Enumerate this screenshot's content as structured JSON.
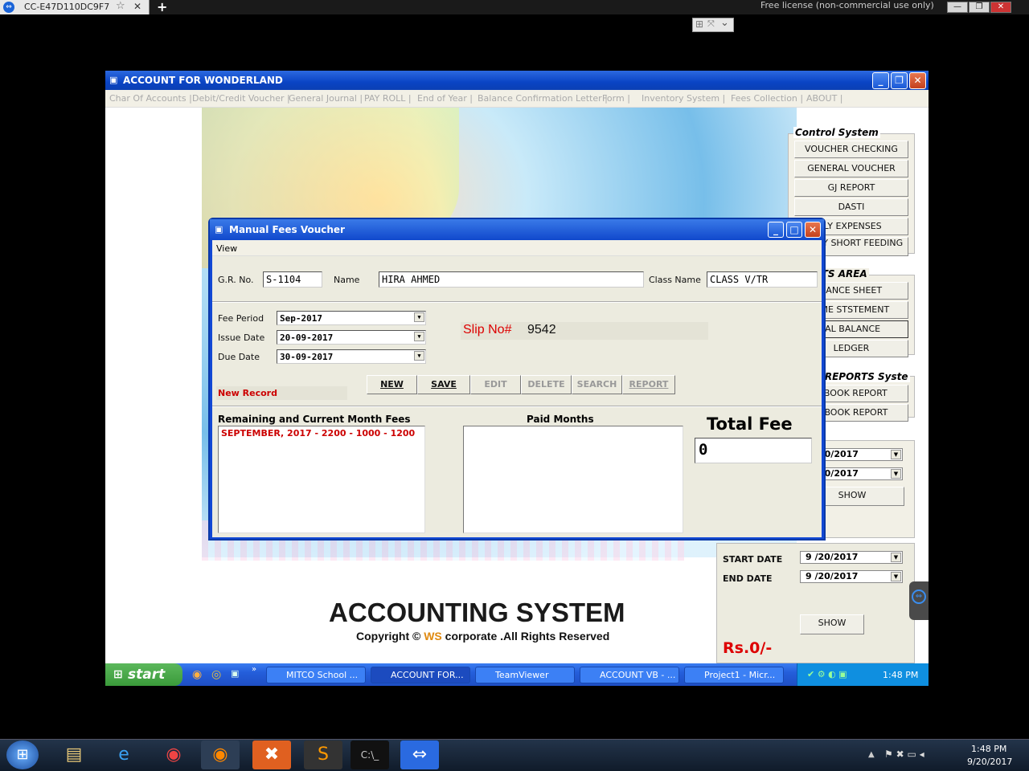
{
  "teamviewer": {
    "tab_label": "CC-E47D110DC9F7",
    "license_text": "Free license (non-commercial use only)"
  },
  "app": {
    "title": "ACCOUNT FOR WONDERLAND",
    "menu": [
      "Char Of Accounts |",
      "Debit/Credit Voucher |",
      "General Journal |",
      "PAY ROLL |",
      "End of Year |",
      "Balance Confirmation Letter |",
      "Form |",
      "Inventory System |",
      "Fees Collection |",
      "ABOUT |"
    ],
    "brand_title": "ACCOUNTING SYSTEM",
    "copyright_pre": "Copyright ©",
    "copyright_ws": "WS",
    "copyright_post": "corporate .All Rights Reserved"
  },
  "control_system": {
    "legend": "Control System",
    "buttons": [
      "VOUCHER CHECKING",
      "GENERAL VOUCHER",
      "GJ REPORT",
      "DASTI",
      "ILY EXPENSES",
      "ALARY SHORT FEEDING"
    ]
  },
  "reports_area": {
    "legend": "RTS AREA",
    "buttons": [
      "LANCE SHEET",
      "OME STSTEMENT",
      "IAL BALANCE",
      "LEDGER"
    ]
  },
  "reports_system": {
    "legend": "Y REPORTS  Syste",
    "buttons": [
      "K BOOK REPORT",
      "H BOOK REPORT"
    ]
  },
  "date_panel_a": {
    "date1": "20/2017",
    "date2": "20/2017",
    "show_label": "SHOW"
  },
  "date_panel_b": {
    "start_label": "START DATE",
    "start_value": "9 /20/2017",
    "end_label": "END DATE",
    "end_value": "9 /20/2017",
    "show_label": "SHOW",
    "amount": "Rs.0/-"
  },
  "dialog": {
    "title": "Manual Fees Voucher",
    "menu_view": "View",
    "gr_label": "G.R. No.",
    "gr_value": "S-1104",
    "name_label": "Name",
    "name_value": "HIRA AHMED",
    "class_label": "Class Name",
    "class_value": "CLASS V/TR",
    "fee_period_label": "Fee Period",
    "fee_period_value": "Sep-2017",
    "issue_date_label": "Issue Date",
    "issue_date_value": "20-09-2017",
    "due_date_label": "Due Date",
    "due_date_value": "30-09-2017",
    "slip_label": "Slip No#",
    "slip_value": "9542",
    "buttons": {
      "new": "NEW",
      "save": "SAVE",
      "edit": "EDIT",
      "delete": "DELETE",
      "search": "SEARCH",
      "report": "REPORT"
    },
    "status": "New Record",
    "remaining_label": "Remaining and Current Month Fees",
    "remaining_items": [
      "SEPTEMBER, 2017 - 2200 - 1000 - 1200"
    ],
    "paid_label": "Paid Months",
    "total_label": "Total Fee",
    "total_value": "0"
  },
  "xp_taskbar": {
    "start_label": "start",
    "items": [
      "MITCO School ...",
      "ACCOUNT FOR...",
      "TeamViewer",
      "ACCOUNT VB - ...",
      "Project1 - Micr..."
    ],
    "clock": "1:48 PM"
  },
  "win7_taskbar": {
    "time": "1:48 PM",
    "date": "9/20/2017"
  },
  "colors": {
    "xp_blue": "#245edb",
    "slip_red": "#d00000",
    "status_red": "#c00000"
  }
}
